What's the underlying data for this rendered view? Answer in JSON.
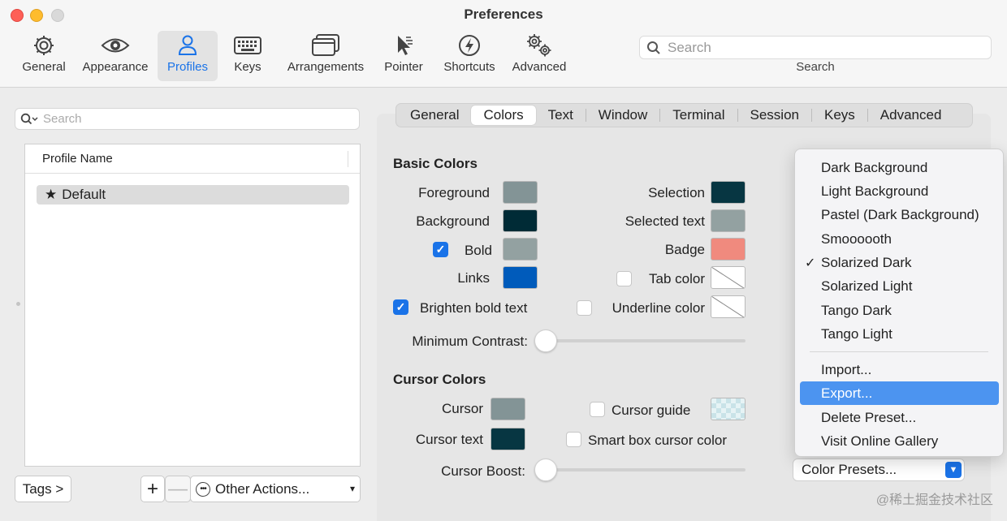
{
  "window": {
    "title": "Preferences"
  },
  "toolbar": {
    "items": [
      {
        "label": "General"
      },
      {
        "label": "Appearance"
      },
      {
        "label": "Profiles"
      },
      {
        "label": "Keys"
      },
      {
        "label": "Arrangements"
      },
      {
        "label": "Pointer"
      },
      {
        "label": "Shortcuts"
      },
      {
        "label": "Advanced"
      }
    ],
    "active": "Profiles",
    "search_placeholder": "Search",
    "search_caption": "Search"
  },
  "profiles": {
    "search_placeholder": "Search",
    "column_header": "Profile Name",
    "items": [
      {
        "name": "Default",
        "is_default": true
      }
    ],
    "tags_button": "Tags >",
    "add_button": "+",
    "remove_button": "—",
    "other_actions": "Other Actions..."
  },
  "tabs": {
    "items": [
      "General",
      "Colors",
      "Text",
      "Window",
      "Terminal",
      "Session",
      "Keys",
      "Advanced"
    ],
    "active": "Colors"
  },
  "basic_colors": {
    "heading": "Basic Colors",
    "foreground": {
      "label": "Foreground",
      "color": "#839496"
    },
    "background": {
      "label": "Background",
      "color": "#002b36"
    },
    "bold": {
      "label": "Bold",
      "checked": true,
      "color": "#93a1a1"
    },
    "links": {
      "label": "Links",
      "color": "#005bbb"
    },
    "brighten": {
      "label": "Brighten bold text",
      "checked": true
    },
    "selection": {
      "label": "Selection",
      "color": "#073642"
    },
    "selected_text": {
      "label": "Selected text",
      "color": "#93a1a1"
    },
    "badge": {
      "label": "Badge",
      "color": "#f08a7e"
    },
    "tab_color": {
      "label": "Tab color",
      "checked": false
    },
    "underline_color": {
      "label": "Underline color",
      "checked": false
    },
    "min_contrast": {
      "label": "Minimum Contrast:",
      "value": 0
    }
  },
  "cursor_colors": {
    "heading": "Cursor Colors",
    "cursor": {
      "label": "Cursor",
      "color": "#839496"
    },
    "cursor_text": {
      "label": "Cursor text",
      "color": "#073642"
    },
    "cursor_guide": {
      "label": "Cursor guide",
      "checked": false
    },
    "smart_box": {
      "label": "Smart box cursor color",
      "checked": false
    },
    "boost": {
      "label": "Cursor Boost:",
      "value": 0
    }
  },
  "presets": {
    "button": "Color Presets...",
    "menu": [
      "Dark Background",
      "Light Background",
      "Pastel (Dark Background)",
      "Smoooooth",
      "Solarized Dark",
      "Solarized Light",
      "Tango Dark",
      "Tango Light"
    ],
    "checked": "Solarized Dark",
    "actions": [
      "Import...",
      "Export...",
      "Delete Preset...",
      "Visit Online Gallery"
    ],
    "highlighted": "Export..."
  },
  "watermark": "@稀土掘金技术社区"
}
